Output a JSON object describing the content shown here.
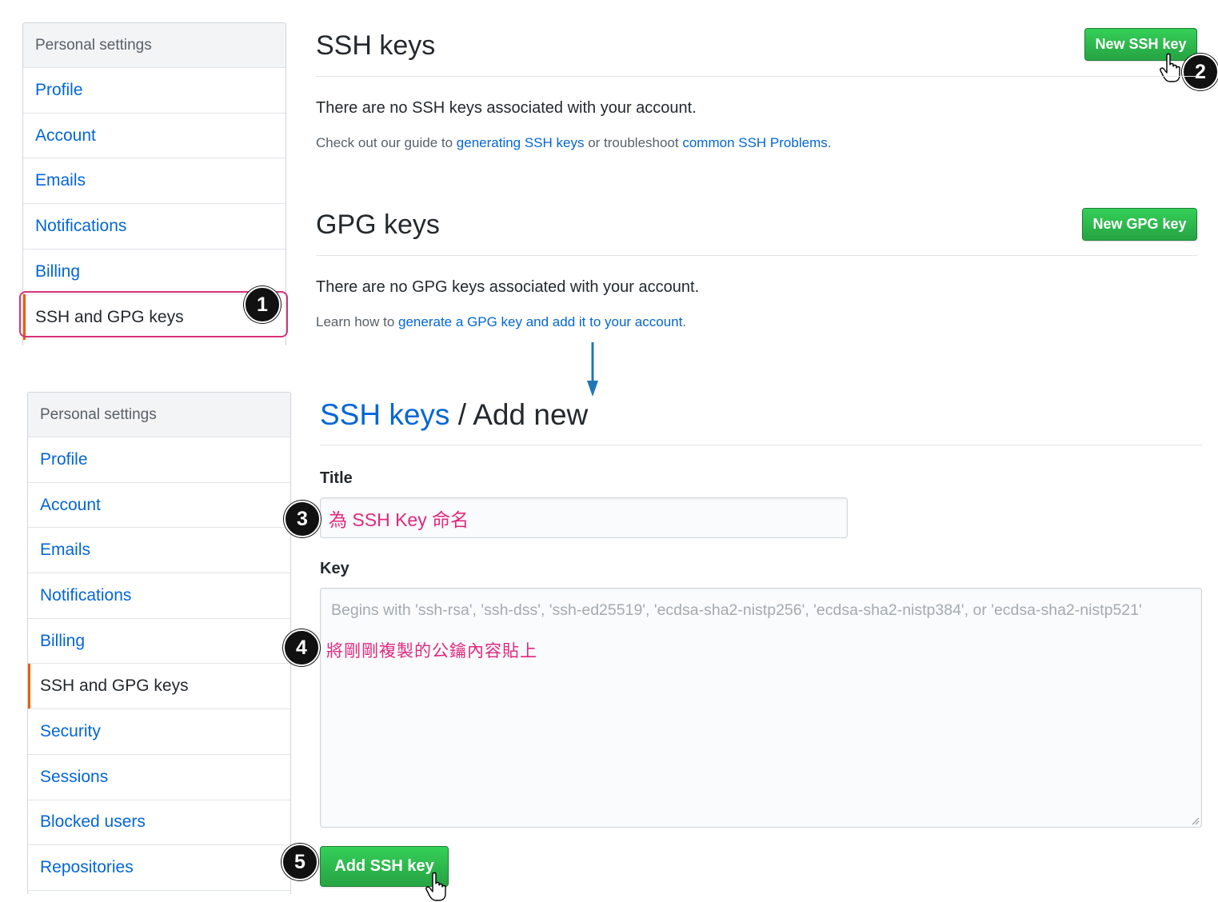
{
  "settings_menu_top": {
    "heading": "Personal settings",
    "items": [
      "Profile",
      "Account",
      "Emails",
      "Notifications",
      "Billing",
      "SSH and GPG keys"
    ],
    "selected": "SSH and GPG keys"
  },
  "settings_menu_bottom": {
    "heading": "Personal settings",
    "items": [
      "Profile",
      "Account",
      "Emails",
      "Notifications",
      "Billing",
      "SSH and GPG keys",
      "Security",
      "Sessions",
      "Blocked users",
      "Repositories"
    ],
    "selected": "SSH and GPG keys"
  },
  "ssh_section": {
    "title": "SSH keys",
    "new_button": "New SSH key",
    "empty_text": "There are no SSH keys associated with your account.",
    "guide_prefix": "Check out our guide to ",
    "guide_link": "generating SSH keys",
    "guide_middle": " or troubleshoot ",
    "problems_link": "common SSH Problems",
    "guide_suffix": "."
  },
  "gpg_section": {
    "title": "GPG keys",
    "new_button": "New GPG key",
    "empty_text": "There are no GPG keys associated with your account.",
    "learn_prefix": "Learn how to ",
    "learn_link": "generate a GPG key and add it to your account",
    "learn_suffix": "."
  },
  "add_new": {
    "breadcrumb_link": "SSH keys",
    "breadcrumb_sep": " / ",
    "breadcrumb_current": "Add new",
    "title_label": "Title",
    "title_value": "為 SSH Key 命名",
    "key_label": "Key",
    "key_placeholder": "Begins with 'ssh-rsa', 'ssh-dss', 'ssh-ed25519', 'ecdsa-sha2-nistp256', 'ecdsa-sha2-nistp384', or 'ecdsa-sha2-nistp521'",
    "key_note": "將剛剛複製的公鑰內容貼上",
    "submit_button": "Add SSH key"
  },
  "step_badges": [
    "1",
    "2",
    "3",
    "4",
    "5"
  ],
  "colors": {
    "link": "#0366d6",
    "button_green": "#28a745",
    "annotation_pink": "#e0287e",
    "selected_bar": "#e36209",
    "arrow_blue": "#1f78b4"
  },
  "icons": [
    "hand-pointer-icon",
    "down-arrow-icon",
    "resize-grip-icon"
  ]
}
